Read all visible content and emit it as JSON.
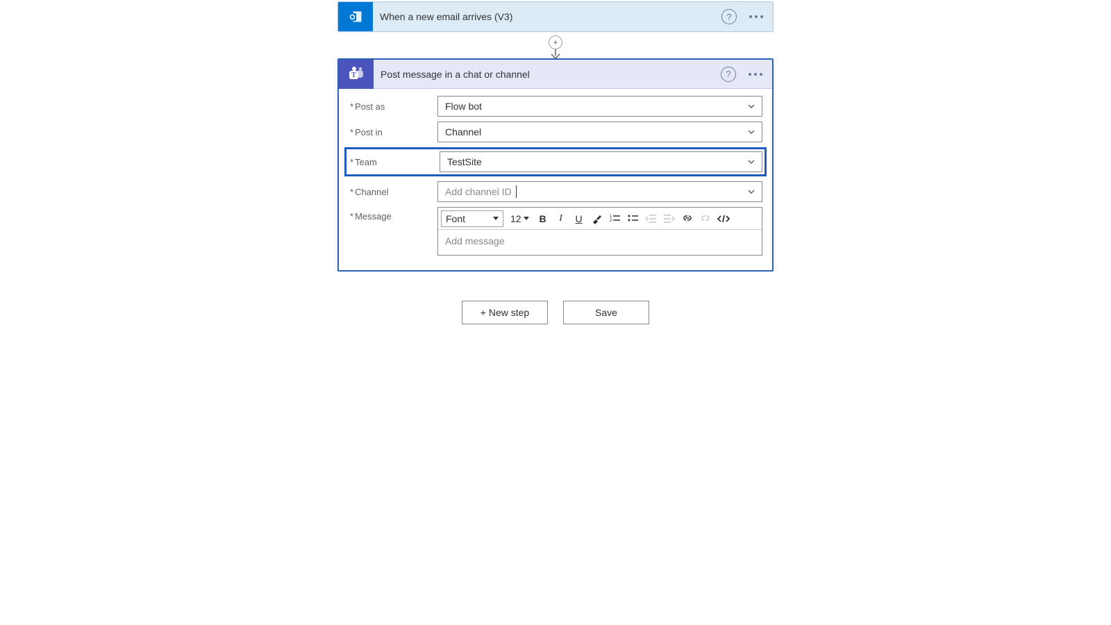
{
  "trigger": {
    "title": "When a new email arrives (V3)"
  },
  "action": {
    "title": "Post message in a chat or channel",
    "fields": {
      "post_as": {
        "label": "Post as",
        "value": "Flow bot"
      },
      "post_in": {
        "label": "Post in",
        "value": "Channel"
      },
      "team": {
        "label": "Team",
        "value": "TestSite"
      },
      "channel": {
        "label": "Channel",
        "placeholder": "Add channel ID"
      },
      "message": {
        "label": "Message",
        "placeholder": "Add message"
      }
    },
    "rte": {
      "font_label": "Font",
      "font_size": "12"
    }
  },
  "buttons": {
    "new_step": "+ New step",
    "save": "Save"
  }
}
